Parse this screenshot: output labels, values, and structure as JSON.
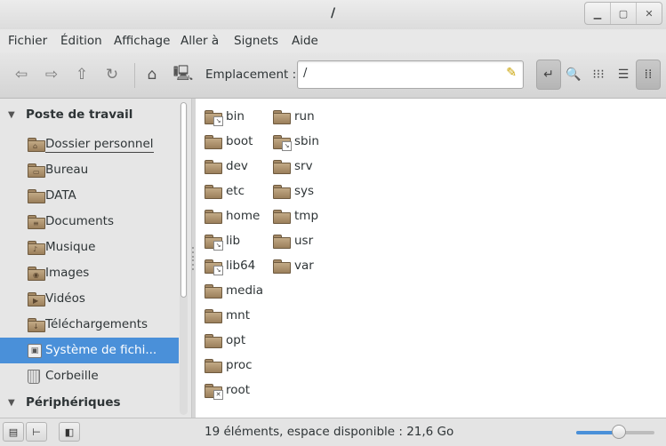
{
  "window": {
    "title": "/"
  },
  "menubar": [
    "Fichier",
    "Édition",
    "Affichage",
    "Aller à",
    "Signets",
    "Aide"
  ],
  "toolbar": {
    "location_label": "Emplacement :",
    "location_value": "/"
  },
  "sidebar": {
    "sections": [
      {
        "label": "Poste de travail",
        "items": [
          {
            "label": "Dossier personnel",
            "icon": "home-folder-icon"
          },
          {
            "label": "Bureau",
            "icon": "desktop-folder-icon"
          },
          {
            "label": "DATA",
            "icon": "folder-icon"
          },
          {
            "label": "Documents",
            "icon": "documents-folder-icon"
          },
          {
            "label": "Musique",
            "icon": "music-folder-icon"
          },
          {
            "label": "Images",
            "icon": "pictures-folder-icon"
          },
          {
            "label": "Vidéos",
            "icon": "videos-folder-icon"
          },
          {
            "label": "Téléchargements",
            "icon": "downloads-folder-icon"
          },
          {
            "label": "Système de fichi...",
            "icon": "filesystem-icon",
            "selected": true
          },
          {
            "label": "Corbeille",
            "icon": "trash-icon"
          }
        ]
      },
      {
        "label": "Périphériques",
        "items": []
      }
    ]
  },
  "files": {
    "col1": [
      {
        "name": "bin",
        "link": true
      },
      {
        "name": "boot"
      },
      {
        "name": "dev"
      },
      {
        "name": "etc"
      },
      {
        "name": "home"
      },
      {
        "name": "lib",
        "link": true
      },
      {
        "name": "lib64",
        "link": true
      },
      {
        "name": "media"
      },
      {
        "name": "mnt"
      },
      {
        "name": "opt"
      },
      {
        "name": "proc"
      },
      {
        "name": "root",
        "locked": true
      }
    ],
    "col2": [
      {
        "name": "run"
      },
      {
        "name": "sbin",
        "link": true
      },
      {
        "name": "srv"
      },
      {
        "name": "sys"
      },
      {
        "name": "tmp"
      },
      {
        "name": "usr"
      },
      {
        "name": "var"
      }
    ]
  },
  "statusbar": {
    "text": "19 éléments, espace disponible : 21,6 Go",
    "zoom_level": 0.55
  },
  "colors": {
    "selection": "#4a90d9",
    "folder": "#a58a67"
  }
}
